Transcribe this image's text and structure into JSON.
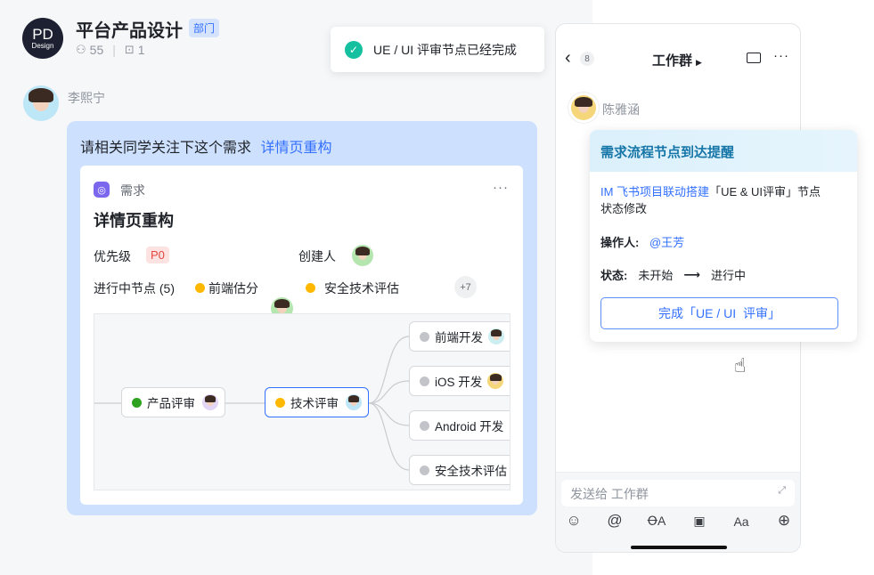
{
  "group": {
    "avatar_line1": "PD",
    "avatar_line2": "Design",
    "title": "平台产品设计",
    "tag": "部门",
    "members": "55",
    "bots": "1"
  },
  "toast": {
    "text": "UE / UI 评审节点已经完成"
  },
  "message": {
    "sender": "李熙宁",
    "text": "请相关同学关注下这个需求",
    "link": "详情页重构"
  },
  "card": {
    "type": "需求",
    "more": "···",
    "title": "详情页重构",
    "priority_label": "优先级",
    "priority": "P0",
    "creator_label": "创建人",
    "nodes_label": "进行中节点 (5)",
    "node1": "前端估分",
    "node2": "安全技术评估",
    "more_count": "+7"
  },
  "flow": {
    "nodes": [
      {
        "label": "产品评审",
        "status": "done"
      },
      {
        "label": "技术评审",
        "status": "active"
      },
      {
        "label": "前端开发",
        "status": "pending"
      },
      {
        "label": "iOS 开发",
        "status": "pending"
      },
      {
        "label": "Android 开发",
        "status": "pending"
      },
      {
        "label": "安全技术评估",
        "status": "pending"
      }
    ]
  },
  "chat": {
    "back_count": "8",
    "title": "工作群",
    "sender": "陈雅涵",
    "input_placeholder": "发送给 工作群"
  },
  "notify": {
    "title": "需求流程节点到达提醒",
    "link": "IM 飞书项目联动搭建",
    "desc": "「UE & UI评审」节点",
    "desc2": "状态修改",
    "operator_label": "操作人:",
    "operator": "@王芳",
    "status_label": "状态:",
    "from": "未开始",
    "to": "进行中",
    "button": "完成「UE / UI  评审」"
  },
  "colors": {
    "accent": "#3370ff",
    "done": "#2ea121",
    "active": "#ffb800",
    "pending": "#c2c4c9"
  }
}
